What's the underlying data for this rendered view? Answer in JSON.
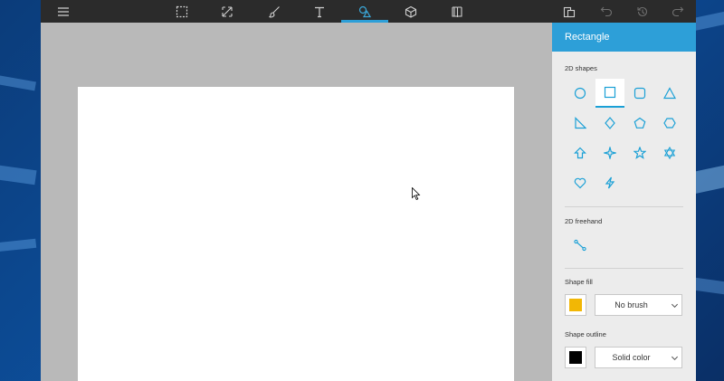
{
  "toolbar": {
    "items": [
      {
        "name": "menu",
        "icon": "hamburger-icon"
      },
      {
        "name": "select",
        "icon": "marquee-select-icon"
      },
      {
        "name": "crop-resize",
        "icon": "resize-arrows-icon"
      },
      {
        "name": "brushes",
        "icon": "brush-icon"
      },
      {
        "name": "text",
        "icon": "text-icon"
      },
      {
        "name": "2d-shapes",
        "icon": "shapes-icon",
        "active": true
      },
      {
        "name": "3d-objects",
        "icon": "cube-icon"
      },
      {
        "name": "stickers",
        "icon": "book-icon"
      },
      {
        "name": "paste",
        "icon": "paste-icon"
      },
      {
        "name": "undo",
        "icon": "undo-icon",
        "disabled": true
      },
      {
        "name": "history",
        "icon": "history-icon",
        "disabled": true
      },
      {
        "name": "redo",
        "icon": "redo-icon",
        "disabled": true
      }
    ]
  },
  "panel": {
    "title": "Rectangle",
    "shapes_label": "2D shapes",
    "shapes": [
      {
        "name": "circle",
        "selected": false
      },
      {
        "name": "rectangle",
        "selected": true
      },
      {
        "name": "rounded-rectangle",
        "selected": false
      },
      {
        "name": "triangle",
        "selected": false
      },
      {
        "name": "right-triangle",
        "selected": false
      },
      {
        "name": "diamond",
        "selected": false
      },
      {
        "name": "pentagon",
        "selected": false
      },
      {
        "name": "hexagon",
        "selected": false
      },
      {
        "name": "arrow-up",
        "selected": false
      },
      {
        "name": "four-point-star",
        "selected": false
      },
      {
        "name": "five-point-star",
        "selected": false
      },
      {
        "name": "six-point-star",
        "selected": false
      },
      {
        "name": "heart",
        "selected": false
      },
      {
        "name": "lightning",
        "selected": false
      }
    ],
    "freehand_label": "2D freehand",
    "freehand_tool": "line-icon",
    "fill_label": "Shape fill",
    "fill_color": "#f2b705",
    "fill_value": "No brush",
    "outline_label": "Shape outline",
    "outline_color": "#000000",
    "outline_value": "Solid color"
  },
  "colors": {
    "accent": "#2d9fd8",
    "toolbar": "#2b2b2b",
    "workspace": "#b9b9b9",
    "panel": "#ececec"
  }
}
